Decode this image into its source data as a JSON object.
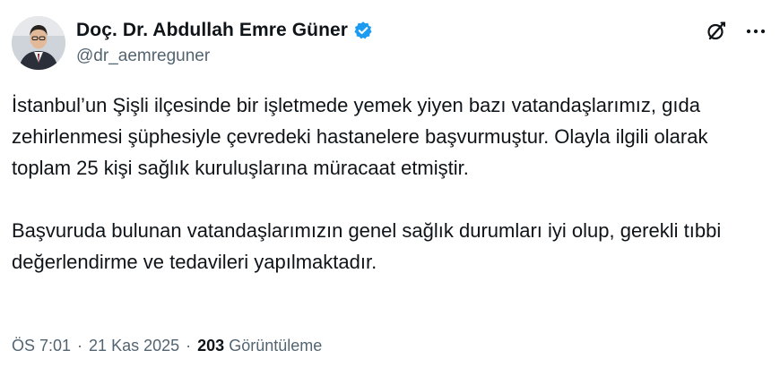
{
  "author": {
    "display_name": "Doç. Dr. Abdullah Emre Güner",
    "handle": "@dr_aemreguner",
    "verified_icon": "verified-badge-icon",
    "verified_color": "#1d9bf0"
  },
  "actions": {
    "grok_icon": "grok-icon",
    "more_icon": "more-options-icon"
  },
  "tweet": {
    "paragraph_1": "İstanbul’un Şişli ilçesinde bir işletmede yemek yiyen bazı vatandaşlarımız, gıda zehirlenmesi şüphesiyle çevredeki hastanelere başvurmuştur. Olayla ilgili olarak toplam 25 kişi sağlık kuruluşlarına müracaat etmiştir.",
    "paragraph_2": "Başvuruda bulunan vatandaşlarımızın genel sağlık durumları iyi olup, gerekli tıbbi değerlendirme ve tedavileri yapılmaktadır."
  },
  "meta": {
    "time": "ÖS 7:01",
    "separator": "·",
    "date": "21 Kas 2025",
    "views_count": "203",
    "views_label": "Görüntüleme"
  },
  "colors": {
    "text": "#0f1419",
    "secondary": "#536471",
    "background": "#ffffff"
  }
}
